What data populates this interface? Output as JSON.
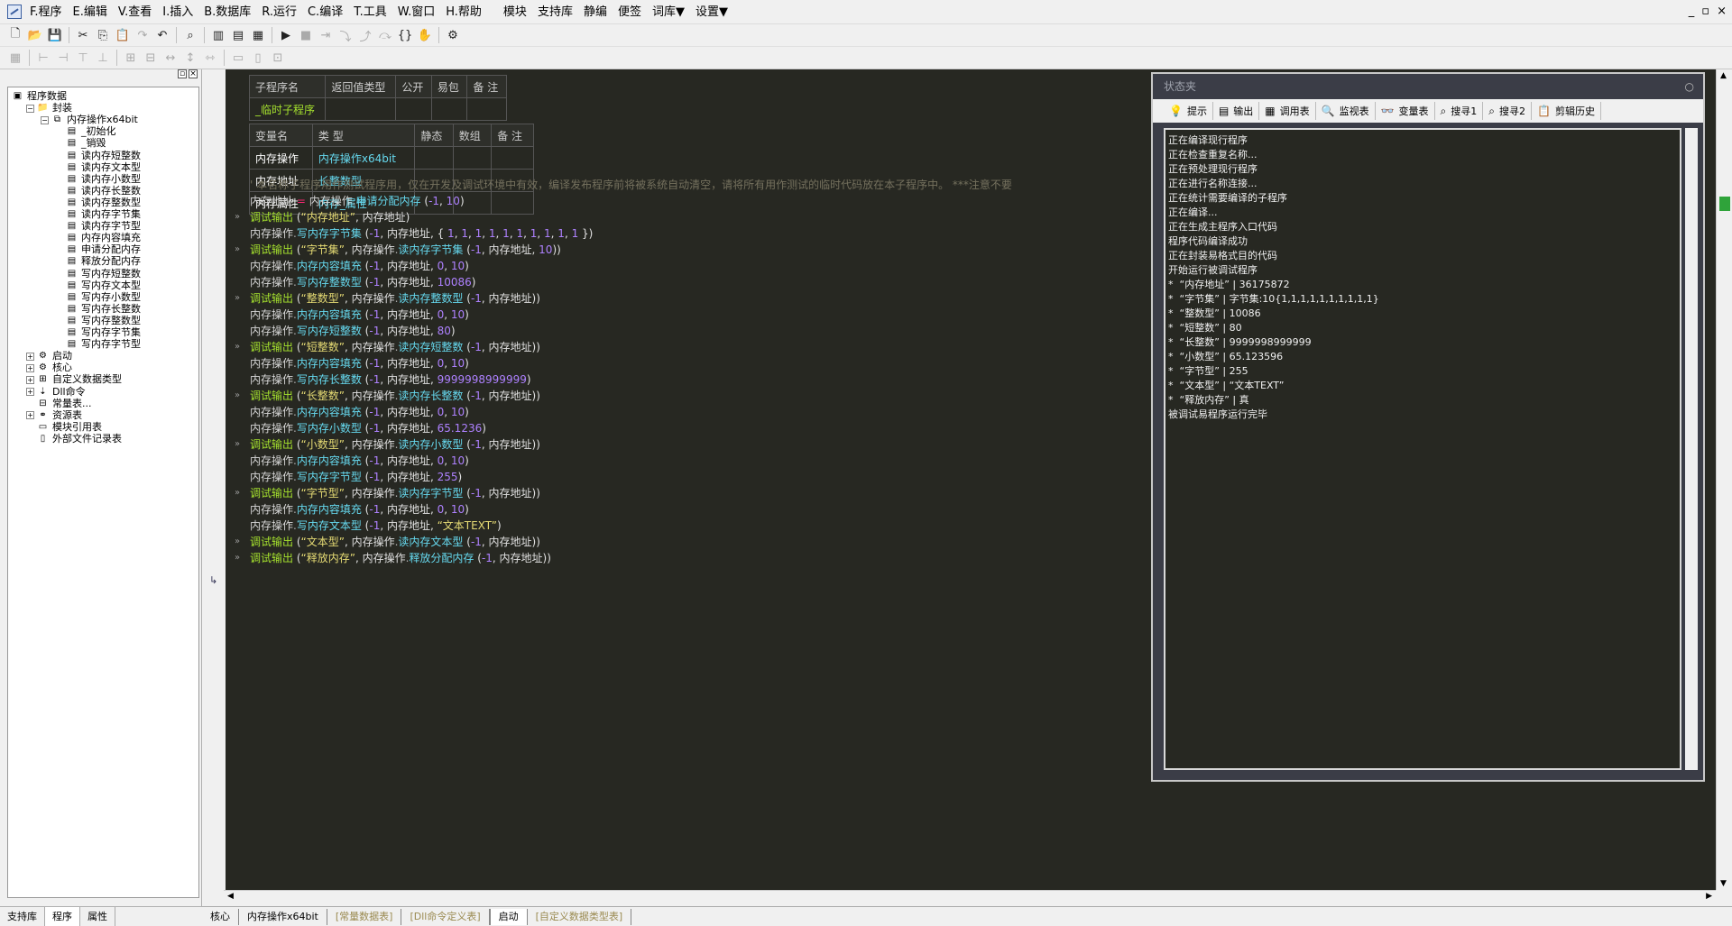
{
  "menubar": {
    "items": [
      "F.程序",
      "E.编辑",
      "V.查看",
      "I.插入",
      "B.数据库",
      "R.运行",
      "C.编译",
      "T.工具",
      "W.窗口",
      "H.帮助"
    ],
    "extra_items": [
      "模块",
      "支持库",
      "静编",
      "便签",
      "词库▼",
      "设置▼"
    ],
    "window_controls": [
      "_",
      "▫",
      "×"
    ]
  },
  "left_panel": {
    "tree": [
      {
        "label": "程序数据",
        "level": 0,
        "icon": "program-data-icon",
        "expand": ""
      },
      {
        "label": "封装",
        "level": 1,
        "icon": "folder-icon",
        "expand": "−"
      },
      {
        "label": "内存操作x64bit",
        "level": 2,
        "icon": "class-icon",
        "expand": "−"
      },
      {
        "label": "_初始化",
        "level": 3,
        "icon": "method-icon",
        "expand": ""
      },
      {
        "label": "_销毁",
        "level": 3,
        "icon": "method-icon",
        "expand": ""
      },
      {
        "label": "读内存短整数",
        "level": 3,
        "icon": "method-icon",
        "expand": ""
      },
      {
        "label": "读内存文本型",
        "level": 3,
        "icon": "method-icon",
        "expand": ""
      },
      {
        "label": "读内存小数型",
        "level": 3,
        "icon": "method-icon",
        "expand": ""
      },
      {
        "label": "读内存长整数",
        "level": 3,
        "icon": "method-icon",
        "expand": ""
      },
      {
        "label": "读内存整数型",
        "level": 3,
        "icon": "method-icon",
        "expand": ""
      },
      {
        "label": "读内存字节集",
        "level": 3,
        "icon": "method-icon",
        "expand": ""
      },
      {
        "label": "读内存字节型",
        "level": 3,
        "icon": "method-icon",
        "expand": ""
      },
      {
        "label": "内存内容填充",
        "level": 3,
        "icon": "method-icon",
        "expand": ""
      },
      {
        "label": "申请分配内存",
        "level": 3,
        "icon": "method-icon",
        "expand": ""
      },
      {
        "label": "释放分配内存",
        "level": 3,
        "icon": "method-icon",
        "expand": ""
      },
      {
        "label": "写内存短整数",
        "level": 3,
        "icon": "method-icon",
        "expand": ""
      },
      {
        "label": "写内存文本型",
        "level": 3,
        "icon": "method-icon",
        "expand": ""
      },
      {
        "label": "写内存小数型",
        "level": 3,
        "icon": "method-icon",
        "expand": ""
      },
      {
        "label": "写内存长整数",
        "level": 3,
        "icon": "method-icon",
        "expand": ""
      },
      {
        "label": "写内存整数型",
        "level": 3,
        "icon": "method-icon",
        "expand": ""
      },
      {
        "label": "写内存字节集",
        "level": 3,
        "icon": "method-icon",
        "expand": ""
      },
      {
        "label": "写内存字节型",
        "level": 3,
        "icon": "method-icon",
        "expand": ""
      },
      {
        "label": "启动",
        "level": 1,
        "icon": "start-icon",
        "expand": "+"
      },
      {
        "label": "核心",
        "level": 1,
        "icon": "core-icon",
        "expand": "+"
      },
      {
        "label": "自定义数据类型",
        "level": 1,
        "icon": "custom-type-icon",
        "expand": "+"
      },
      {
        "label": "Dll命令",
        "level": 1,
        "icon": "dll-icon",
        "expand": "+"
      },
      {
        "label": "常量表...",
        "level": 1,
        "icon": "constant-icon",
        "expand": ""
      },
      {
        "label": "资源表",
        "level": 1,
        "icon": "resource-icon",
        "expand": "+"
      },
      {
        "label": "模块引用表",
        "level": 1,
        "icon": "module-icon",
        "expand": ""
      },
      {
        "label": "外部文件记录表",
        "level": 1,
        "icon": "file-record-icon",
        "expand": ""
      }
    ],
    "tabs": [
      "支持库",
      "程序",
      "属性"
    ]
  },
  "sub_table": {
    "headers": [
      "子程序名",
      "返回值类型",
      "公开",
      "易包",
      "备 注"
    ],
    "row": [
      "_临时子程序",
      "",
      "",
      "",
      ""
    ]
  },
  "var_table": {
    "headers": [
      "变量名",
      "类 型",
      "静态",
      "数组",
      "备 注"
    ],
    "rows": [
      [
        "内存操作",
        "内存操作x64bit"
      ],
      [
        "内存地址",
        "长整数型"
      ],
      [
        "内存属性",
        "内存_属性"
      ]
    ]
  },
  "code": {
    "comment": "' 本名称子程序用作测试程序用，仅在开发及调试环境中有效，编译发布程序前将被系统自动清空，请将所有用作测试的临时代码放在本子程序中。 ***注意不要"
  },
  "status_panel": {
    "title": "状态夹",
    "tabs": [
      {
        "icon": "hint-icon",
        "glyph": "💡",
        "label": "提示"
      },
      {
        "icon": "output-icon",
        "glyph": "▤",
        "label": "输出"
      },
      {
        "icon": "call-table-icon",
        "glyph": "▦",
        "label": "调用表"
      },
      {
        "icon": "monitor-icon",
        "glyph": "🔍",
        "label": "监视表"
      },
      {
        "icon": "variable-icon",
        "glyph": "👓",
        "label": "变量表"
      },
      {
        "icon": "search1-icon",
        "glyph": "⌕",
        "label": "搜寻1"
      },
      {
        "icon": "search2-icon",
        "glyph": "⌕",
        "label": "搜寻2"
      },
      {
        "icon": "clipboard-icon",
        "glyph": "📋",
        "label": "剪辑历史"
      }
    ],
    "output": [
      "正在编译现行程序",
      "正在检查重复名称...",
      "正在预处理现行程序",
      "正在进行名称连接...",
      "正在统计需要编译的子程序",
      "正在编译...",
      "正在生成主程序入口代码",
      "程序代码编译成功",
      "正在封装易格式目的代码",
      "开始运行被调试程序",
      "*  “内存地址” | 36175872",
      "*  “字节集” | 字节集:10{1,1,1,1,1,1,1,1,1,1}",
      "*  “整数型” | 10086",
      "*  “短整数” | 80",
      "*  “长整数” | 9999998999999",
      "*  “小数型” | 65.123596",
      "*  “字节型” | 255",
      "*  “文本型” | “文本TEXT”",
      "*  “释放内存” | 真",
      "被调试易程序运行完毕"
    ]
  },
  "bottom_tabs": [
    {
      "label": "核心",
      "style": "normal"
    },
    {
      "label": "内存操作x64bit",
      "style": "normal"
    },
    {
      "label": "[常量数据表]",
      "style": "grey"
    },
    {
      "label": "[Dll命令定义表]",
      "style": "grey"
    },
    {
      "label": "启动",
      "style": "active"
    },
    {
      "label": "[自定义数据类型表]",
      "style": "grey"
    }
  ],
  "colors": {
    "editor_bg": "#272822",
    "method": "#66d9ef",
    "number": "#ae81ff",
    "string": "#e6db74",
    "keyword": "#a6e22e"
  }
}
